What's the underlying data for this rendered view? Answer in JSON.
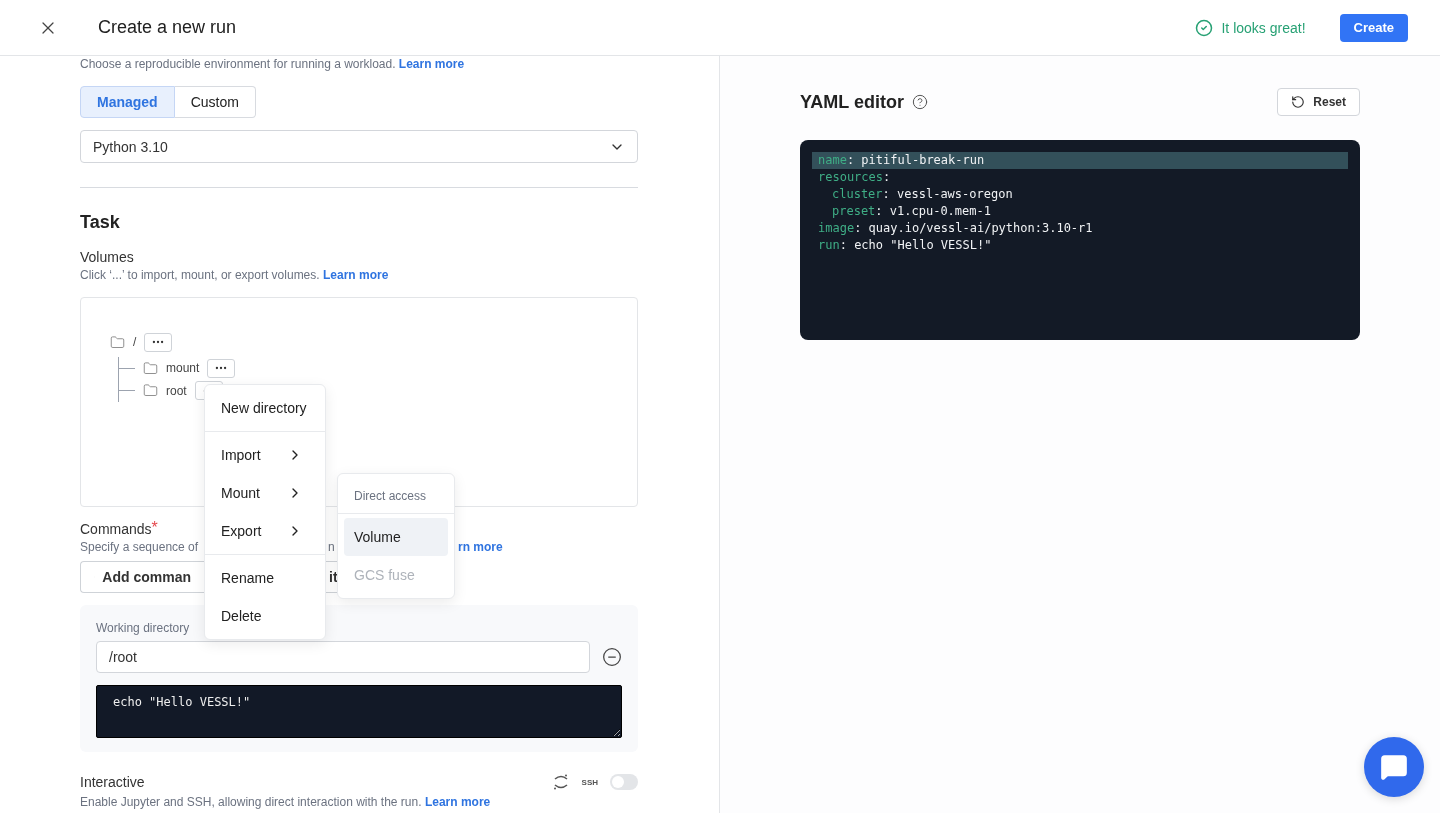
{
  "header": {
    "title": "Create a new run",
    "status": "It looks great!",
    "create_button": "Create"
  },
  "environment": {
    "description": "Choose a reproducible environment for running a workload.",
    "learn_more": "Learn more",
    "tabs": [
      {
        "label": "Managed",
        "selected": true
      },
      {
        "label": "Custom",
        "selected": false
      }
    ],
    "image_select": {
      "value": "Python 3.10"
    }
  },
  "task": {
    "title": "Task",
    "volumes": {
      "label": "Volumes",
      "description": "Click ‘...’ to import, mount, or export volumes.",
      "learn_more": "Learn more",
      "tree": [
        {
          "name": "/",
          "children": [
            {
              "name": "mount"
            },
            {
              "name": "root"
            }
          ]
        }
      ]
    },
    "commands": {
      "label": "Commands",
      "required_mark": "*",
      "description_parts": [
        "Specify a sequence of",
        "n",
        "rn more"
      ],
      "add_button": "Add comman",
      "second_button": "it",
      "working_directory_label": "Working directory",
      "working_directory": "/root",
      "command": "echo \"Hello VESSL!\""
    },
    "interactive": {
      "label": "Interactive",
      "ssh_label": "SSH",
      "on": false,
      "description": "Enable Jupyter and SSH, allowing direct interaction with the run.",
      "learn_more": "Learn more"
    }
  },
  "context_menu": {
    "groups": [
      [
        {
          "label": "New directory",
          "kind": "item"
        }
      ],
      [
        {
          "label": "Import",
          "kind": "submenu"
        },
        {
          "label": "Mount",
          "kind": "submenu"
        },
        {
          "label": "Export",
          "kind": "submenu"
        }
      ],
      [
        {
          "label": "Rename",
          "kind": "item"
        },
        {
          "label": "Delete",
          "kind": "item"
        }
      ]
    ]
  },
  "submenu": {
    "header": "Direct access",
    "items": [
      {
        "label": "Volume",
        "selected": true,
        "disabled": false
      },
      {
        "label": "GCS fuse",
        "selected": false,
        "disabled": true
      }
    ]
  },
  "yaml_editor": {
    "title": "YAML editor",
    "reset_button": "Reset",
    "lines": [
      {
        "key": "name",
        "value": ": pitiful-break-run",
        "highlighted": true
      },
      {
        "key": "resources",
        "value": ":",
        "highlighted": false,
        "children": [
          {
            "key": "cluster",
            "value": ": vessl-aws-oregon",
            "highlighted": false
          },
          {
            "key": "preset",
            "value": ": v1.cpu-0.mem-1",
            "highlighted": false
          }
        ]
      },
      {
        "key": "image",
        "value": ": quay.io/vessl-ai/python:3.10-r1",
        "highlighted": false
      },
      {
        "key": "run",
        "value": ": echo \"Hello VESSL!\"",
        "highlighted": false
      }
    ]
  }
}
